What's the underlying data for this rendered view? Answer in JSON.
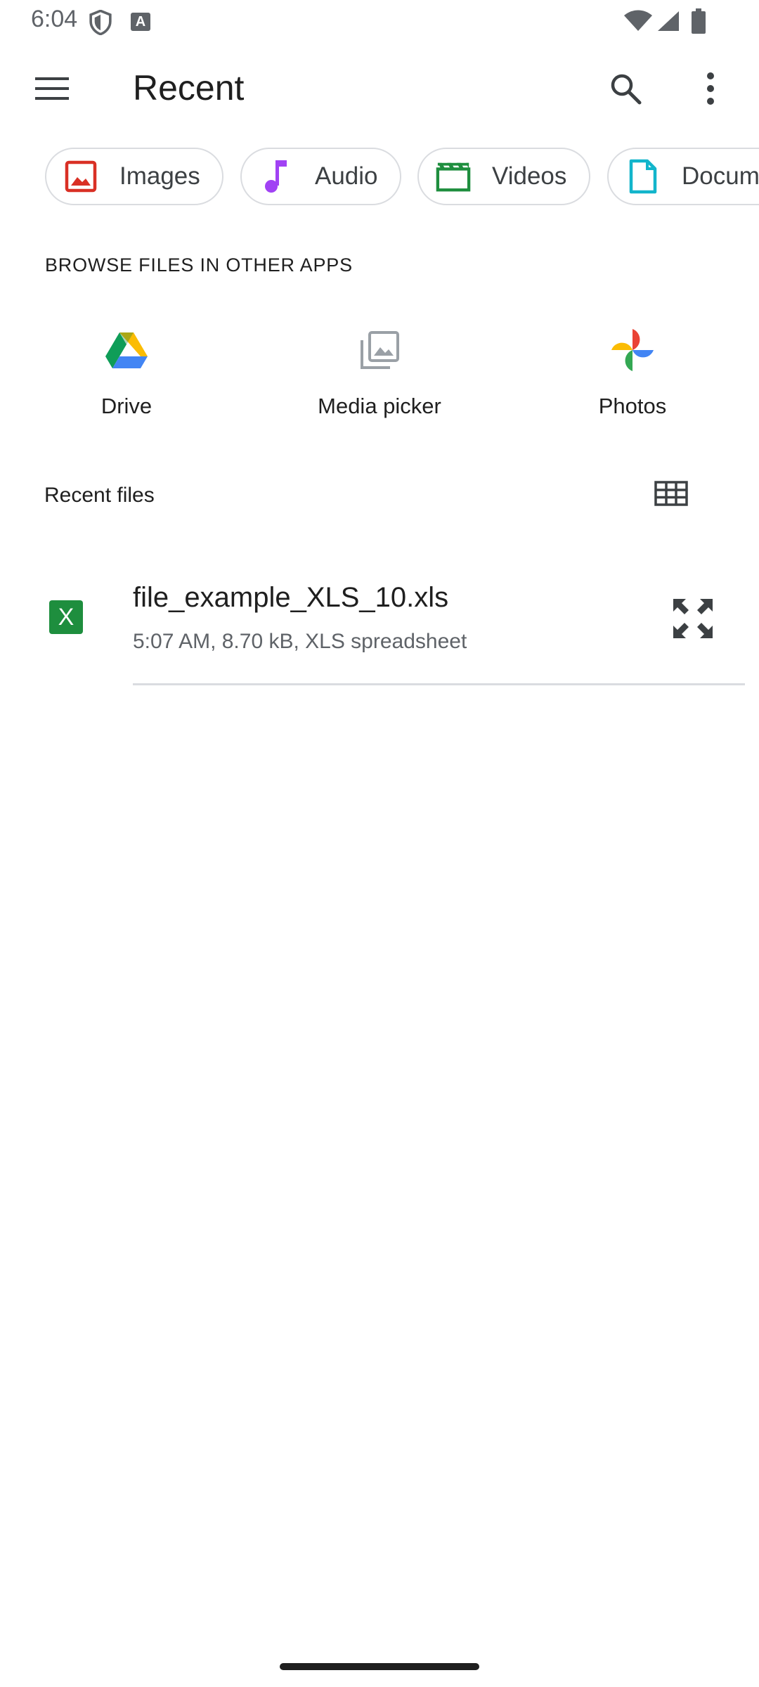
{
  "status_bar": {
    "time": "6:04",
    "a_glyph": "A"
  },
  "app_bar": {
    "title": "Recent",
    "menu_icon": "hamburger-menu-icon",
    "search_icon": "search-icon",
    "more_icon": "more-vert-icon"
  },
  "chips": [
    {
      "label": "Images",
      "icon": "image-icon",
      "color": "#d93025"
    },
    {
      "label": "Audio",
      "icon": "music-note-icon",
      "color": "#a142f4"
    },
    {
      "label": "Videos",
      "icon": "movie-clapper-icon",
      "color": "#1e8e3e"
    },
    {
      "label": "Documents",
      "icon": "document-icon",
      "color": "#12b5cb"
    }
  ],
  "browse": {
    "heading": "BROWSE FILES IN OTHER APPS",
    "apps": [
      {
        "label": "Drive",
        "icon": "google-drive-icon"
      },
      {
        "label": "Media picker",
        "icon": "photo-library-icon"
      },
      {
        "label": "Photos",
        "icon": "google-photos-icon"
      }
    ]
  },
  "recent": {
    "heading": "Recent files",
    "view_toggle_icon": "grid-view-icon",
    "files": [
      {
        "name": "file_example_XLS_10.xls",
        "meta": "5:07 AM, 8.70 kB, XLS spreadsheet",
        "type_glyph": "X",
        "type_color": "#1e8e3e",
        "action_icon": "expand-icon"
      }
    ]
  }
}
